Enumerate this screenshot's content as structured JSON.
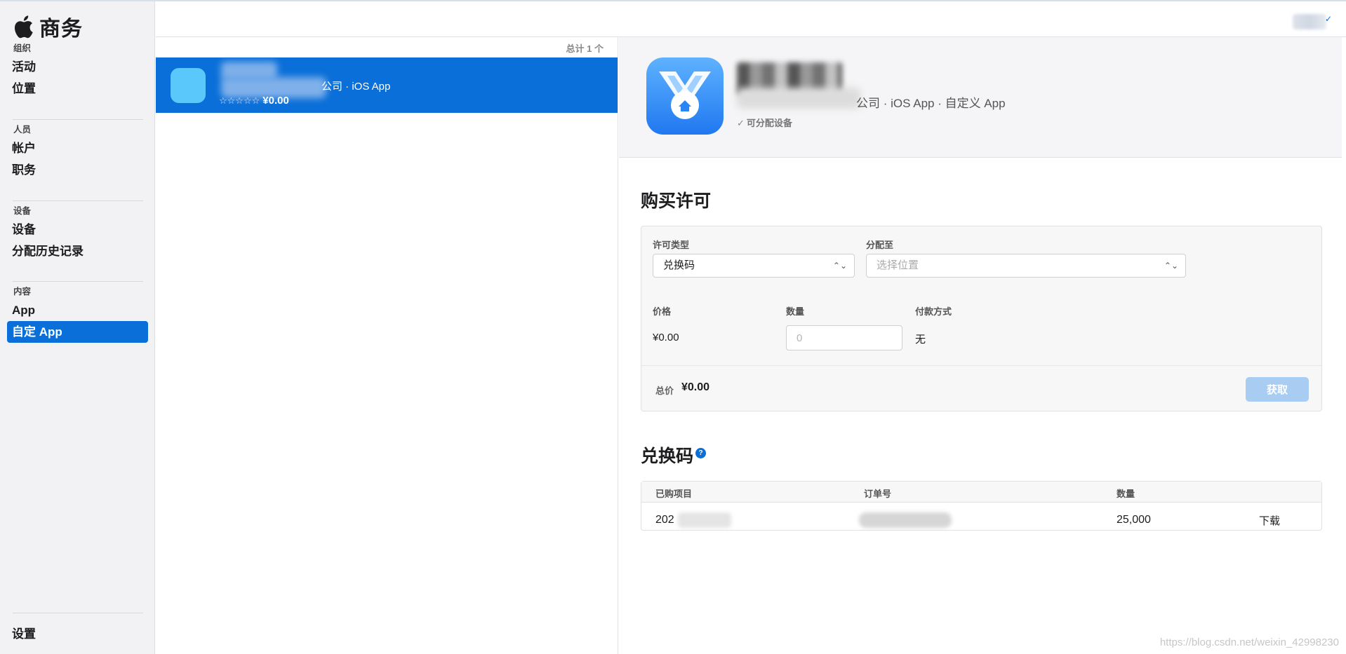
{
  "brand": {
    "name": "商务",
    "logo_icon": "apple-logo-icon"
  },
  "sidebar": {
    "groups": [
      {
        "header": "组织",
        "items": [
          {
            "label": "活动"
          },
          {
            "label": "位置"
          }
        ]
      },
      {
        "header": "人员",
        "items": [
          {
            "label": "帐户"
          },
          {
            "label": "职务"
          }
        ]
      },
      {
        "header": "设备",
        "items": [
          {
            "label": "设备"
          },
          {
            "label": "分配历史记录"
          }
        ]
      },
      {
        "header": "内容",
        "items": [
          {
            "label": "App"
          },
          {
            "label": "自定 App",
            "active": true
          }
        ]
      }
    ],
    "settings_label": "设置"
  },
  "list": {
    "count_label": "总计 1 个",
    "rows": [
      {
        "subtitle_suffix": "公司 · iOS App",
        "stars": "☆☆☆☆☆",
        "price": "¥0.00",
        "icon_color": "#5ac8fa"
      }
    ]
  },
  "detail": {
    "subtitle_suffix": "公司 · iOS App · 自定义 App",
    "assignable_label": "可分配设备",
    "purchase": {
      "title": "购买许可",
      "license_type_label": "许可类型",
      "license_type_value": "兑换码",
      "assign_to_label": "分配至",
      "assign_to_placeholder": "选择位置",
      "price_label": "价格",
      "price_value": "¥0.00",
      "quantity_label": "数量",
      "quantity_placeholder": "0",
      "payment_label": "付款方式",
      "payment_value": "无",
      "total_label": "总价",
      "total_value": "¥0.00",
      "get_button": "获取"
    },
    "codes": {
      "title": "兑换码",
      "help_glyph": "?",
      "columns": [
        "已购项目",
        "订单号",
        "数量"
      ],
      "rows": [
        {
          "item_prefix": "202",
          "quantity": "25,000",
          "action": "下载"
        }
      ]
    }
  },
  "colors": {
    "accent": "#0a6fd8",
    "button_disabled": "#a9cdf2",
    "sidebar_bg": "#f2f2f4"
  },
  "watermark": "https://blog.csdn.net/weixin_42998230"
}
